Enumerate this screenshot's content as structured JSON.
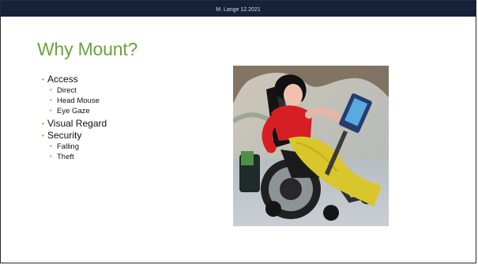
{
  "header": {
    "footer_text": "M. Lange 12.2021"
  },
  "title": "Why Mount?",
  "bullets": [
    {
      "label": "Access",
      "children": [
        "Direct",
        "Head Mouse",
        "Eye Gaze"
      ]
    },
    {
      "label": "Visual Regard",
      "children": []
    },
    {
      "label": "Security",
      "children": [
        "Falling",
        "Theft"
      ]
    }
  ],
  "photo": {
    "subject_icon": "wheelchair-user-photo"
  },
  "colors": {
    "accent": "#6aa33b",
    "top_bar": "#16213a"
  }
}
